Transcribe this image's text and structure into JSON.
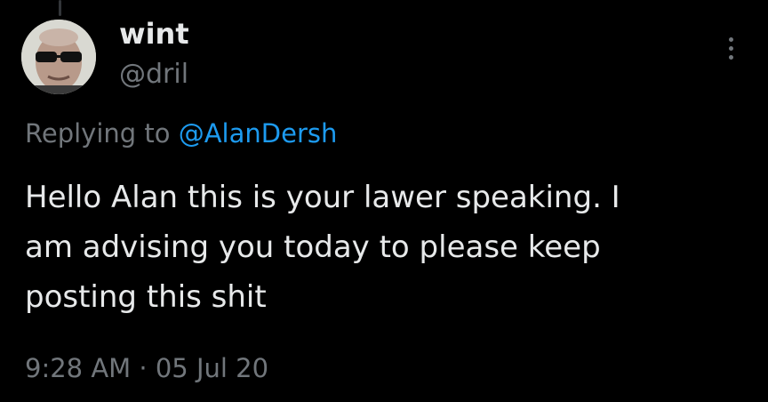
{
  "author": {
    "display_name": "wint",
    "handle": "@dril",
    "avatar_icon": "sunglasses-man-avatar"
  },
  "more_menu": {
    "icon": "more-vertical-icon"
  },
  "reply_context": {
    "prefix": "Replying to ",
    "mention": "@AlanDersh"
  },
  "tweet": {
    "text": "Hello Alan this is your lawer speaking.  I\nam advising you today to please keep\nposting this shit"
  },
  "meta": {
    "time": "9:28 AM",
    "separator": " · ",
    "date": "05 Jul 20"
  },
  "colors": {
    "background": "#000000",
    "primary_text": "#e7e9ea",
    "secondary_text": "#71767b",
    "link": "#1d9bf0"
  }
}
